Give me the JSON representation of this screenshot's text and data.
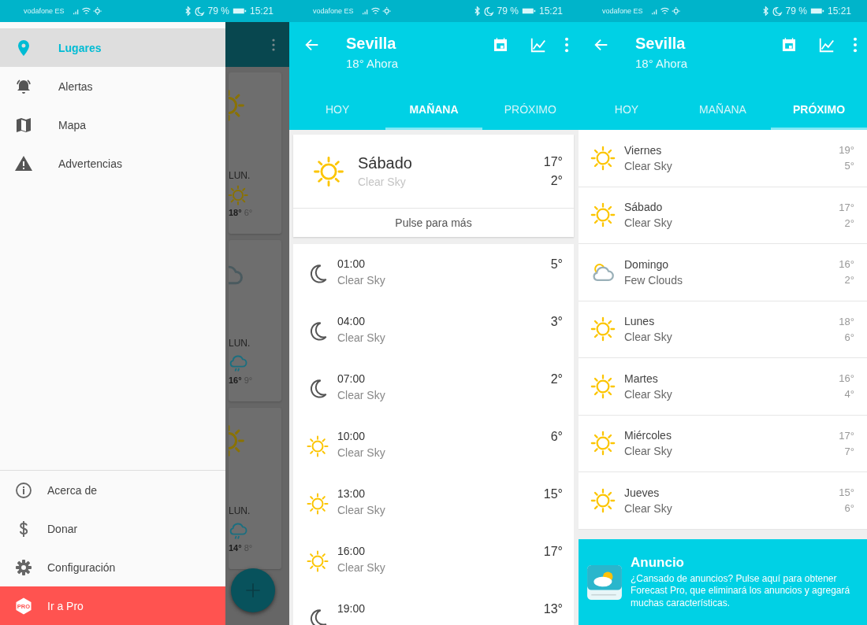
{
  "drawer_screen": {
    "status_bar": {
      "carrier": "vodafone ES",
      "battery": "79 %",
      "time": "15:21"
    },
    "drawer": {
      "items": [
        {
          "label": "Lugares",
          "selected": true
        },
        {
          "label": "Alertas",
          "selected": false
        },
        {
          "label": "Mapa",
          "selected": false
        },
        {
          "label": "Advertencias",
          "selected": false
        }
      ],
      "bottom_items": [
        {
          "label": "Acerca de"
        },
        {
          "label": "Donar"
        },
        {
          "label": "Configuración"
        }
      ],
      "pro_button": {
        "badge": "PRO",
        "label": "Ir a Pro"
      }
    },
    "background_cards": [
      {
        "kind": "sunny",
        "forecast": {
          "day": "LUN.",
          "kind": "sunny",
          "high": "18°",
          "low": "6°"
        }
      },
      {
        "kind": "cloudy",
        "forecast": {
          "day": "LUN.",
          "kind": "rain",
          "high": "16°",
          "low": "9°"
        }
      },
      {
        "kind": "sunny",
        "forecast": {
          "day": "LUN.",
          "kind": "rain",
          "high": "14°",
          "low": "8°"
        }
      }
    ]
  },
  "tomorrow_screen": {
    "status_bar": {
      "carrier": "vodafone ES",
      "battery": "79 %",
      "time": "15:21"
    },
    "app_bar": {
      "title": "Sevilla",
      "subtitle": "18° Ahora"
    },
    "tabs": [
      {
        "label": "HOY",
        "selected": false
      },
      {
        "label": "MAÑANA",
        "selected": true
      },
      {
        "label": "PRÓXIMO",
        "selected": false
      }
    ],
    "summary": {
      "kind": "sunny",
      "day": "Sábado",
      "condition": "Clear Sky",
      "high": "17°",
      "low": "2°",
      "more": "Pulse para más"
    },
    "hours": [
      {
        "kind": "night",
        "time": "01:00",
        "condition": "Clear Sky",
        "temp": "5°"
      },
      {
        "kind": "night",
        "time": "04:00",
        "condition": "Clear Sky",
        "temp": "3°"
      },
      {
        "kind": "night",
        "time": "07:00",
        "condition": "Clear Sky",
        "temp": "2°"
      },
      {
        "kind": "sunny",
        "time": "10:00",
        "condition": "Clear Sky",
        "temp": "6°"
      },
      {
        "kind": "sunny",
        "time": "13:00",
        "condition": "Clear Sky",
        "temp": "15°"
      },
      {
        "kind": "sunny",
        "time": "16:00",
        "condition": "Clear Sky",
        "temp": "17°"
      },
      {
        "kind": "night",
        "time": "19:00",
        "temp": "13°"
      }
    ]
  },
  "upcoming_screen": {
    "status_bar": {
      "carrier": "vodafone ES",
      "battery": "79 %",
      "time": "15:21"
    },
    "app_bar": {
      "title": "Sevilla",
      "subtitle": "18° Ahora"
    },
    "tabs": [
      {
        "label": "HOY",
        "selected": false
      },
      {
        "label": "MAÑANA",
        "selected": false
      },
      {
        "label": "PRÓXIMO",
        "selected": true
      }
    ],
    "days": [
      {
        "kind": "sunny",
        "day": "Viernes",
        "condition": "Clear Sky",
        "high": "19°",
        "low": "5°"
      },
      {
        "kind": "sunny",
        "day": "Sábado",
        "condition": "Clear Sky",
        "high": "17°",
        "low": "2°"
      },
      {
        "kind": "partly",
        "day": "Domingo",
        "condition": "Few Clouds",
        "high": "16°",
        "low": "2°"
      },
      {
        "kind": "sunny",
        "day": "Lunes",
        "condition": "Clear Sky",
        "high": "18°",
        "low": "6°"
      },
      {
        "kind": "sunny",
        "day": "Martes",
        "condition": "Clear Sky",
        "high": "16°",
        "low": "4°"
      },
      {
        "kind": "sunny",
        "day": "Miércoles",
        "condition": "Clear Sky",
        "high": "17°",
        "low": "7°"
      },
      {
        "kind": "sunny",
        "day": "Jueves",
        "condition": "Clear Sky",
        "high": "15°",
        "low": "6°"
      }
    ],
    "ad": {
      "title": "Anuncio",
      "text": "¿Cansado de anuncios? Pulse aquí para obtener Forecast Pro, que eliminará los anuncios y agregará muchas características."
    }
  }
}
